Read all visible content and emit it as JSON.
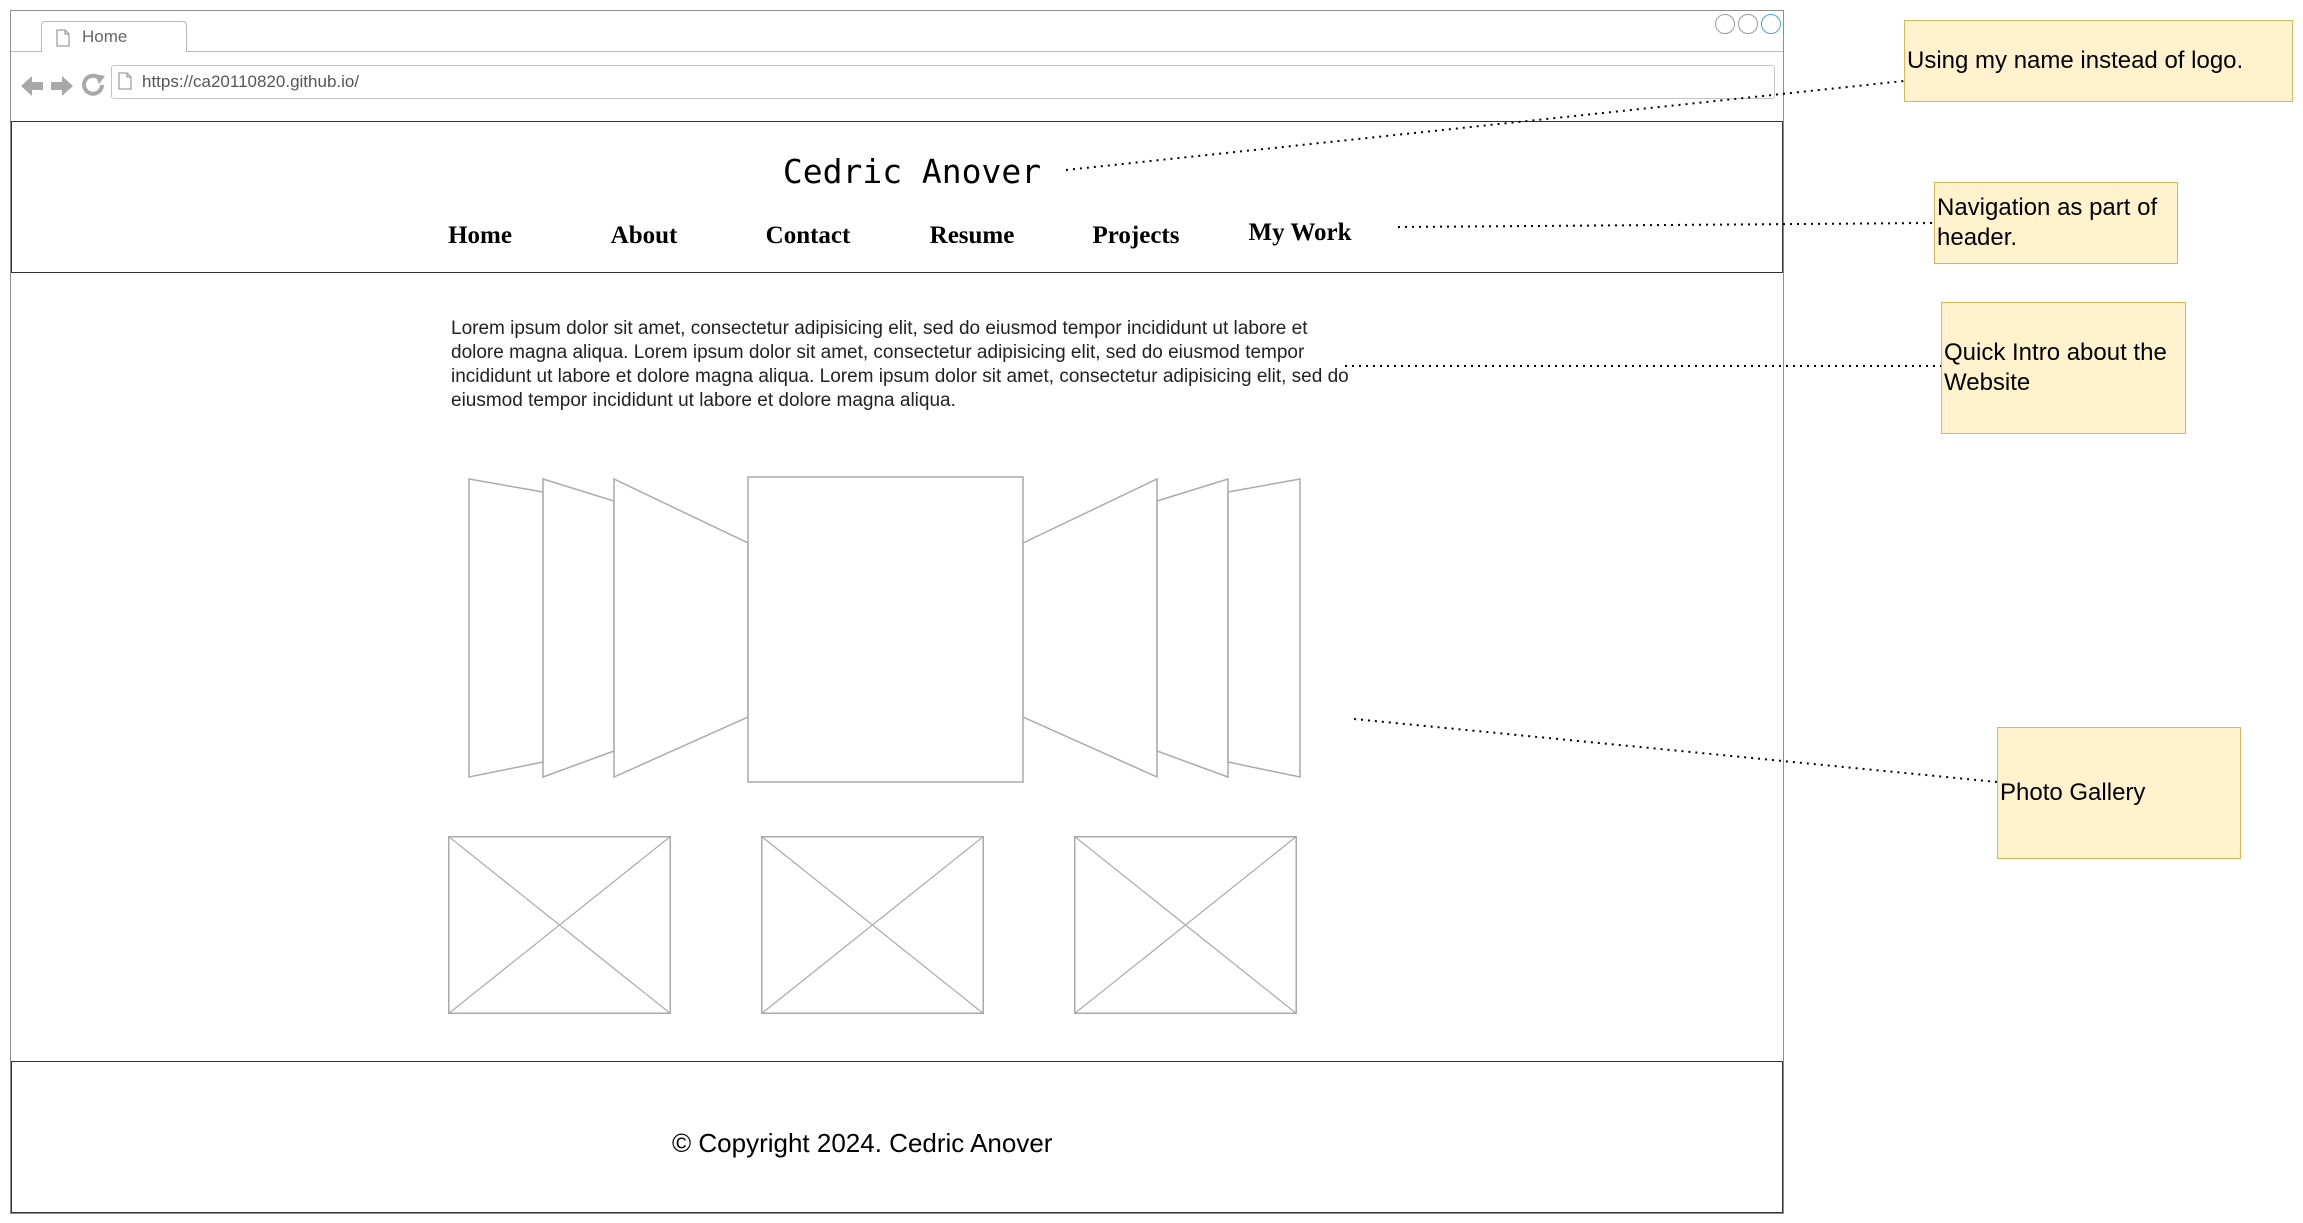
{
  "browser": {
    "tab_title": "Home",
    "url": "https://ca20110820.github.io/"
  },
  "header": {
    "site_name": "Cedric Anover",
    "nav": [
      "Home",
      "About",
      "Contact",
      "Resume",
      "Projects",
      "My Work"
    ]
  },
  "intro": {
    "text": "Lorem ipsum dolor sit amet, consectetur adipisicing elit, sed do eiusmod tempor incididunt ut labore et dolore magna aliqua. Lorem ipsum dolor sit amet, consectetur adipisicing elit, sed do eiusmod tempor incididunt ut labore et dolore magna aliqua. Lorem ipsum dolor sit amet, consectetur adipisicing elit, sed do eiusmod tempor incididunt ut labore et dolore magna aliqua."
  },
  "footer": {
    "copyright": "© Copyright 2024. Cedric Anover"
  },
  "notes": {
    "logo": "Using my name instead of logo.",
    "navigation": "Navigation as part of header.",
    "intro": "Quick Intro about the Website",
    "gallery": "Photo Gallery"
  },
  "colors": {
    "note_fill": "#fff2cc",
    "note_border": "#d6b656",
    "wire": "#aaaaaa",
    "window_control_accent": "#43a6e8"
  },
  "icons": [
    "document-icon",
    "back-arrow-icon",
    "forward-arrow-icon",
    "reload-icon",
    "window-control-icon",
    "image-placeholder-icon"
  ]
}
